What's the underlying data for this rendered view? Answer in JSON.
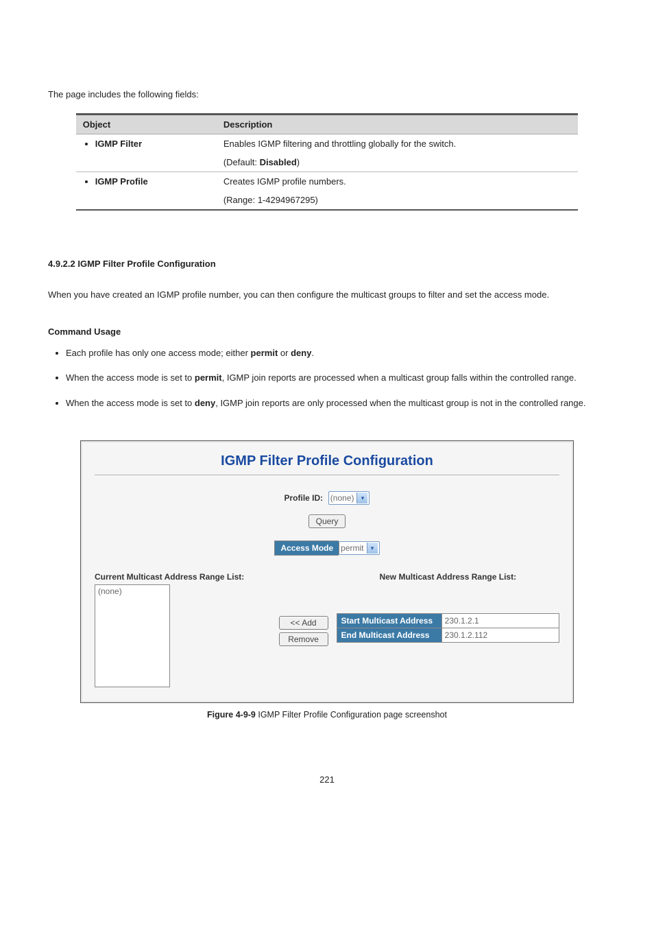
{
  "intro": "The page includes the following fields:",
  "table": {
    "h1": "Object",
    "h2": "Description",
    "rows": [
      {
        "obj": "IGMP Filter",
        "d1": "Enables IGMP filtering and throttling globally for the switch.",
        "d2a": "(Default: ",
        "d2b": "Disabled",
        "d2c": ")"
      },
      {
        "obj": "IGMP Profile",
        "d1": "Creates IGMP profile numbers.",
        "d2": "(Range: 1-4294967295)"
      }
    ]
  },
  "section_num": "4.9.2.2 IGMP Filter Profile Configuration",
  "section_para": "When you have created an IGMP profile number, you can then configure the multicast groups to filter and set the access mode.",
  "usage_head": "Command Usage",
  "usage": {
    "i1a": "Each profile has only one access mode; either ",
    "i1b": "permit",
    "i1c": " or ",
    "i1d": "deny",
    "i1e": ".",
    "i2a": "When the access mode is set to ",
    "i2b": "permit",
    "i2c": ", IGMP join reports are processed when a multicast group falls within the controlled range.",
    "i3a": "When the access mode is set to ",
    "i3b": "deny",
    "i3c": ", IGMP join reports are only processed when the multicast group is not in the controlled range."
  },
  "shot": {
    "title": "IGMP Filter Profile Configuration",
    "profile_label": "Profile ID:",
    "profile_value": "(none)",
    "query_btn": "Query",
    "access_label": "Access Mode",
    "access_value": "permit",
    "cur_hdr": "Current Multicast Address Range List:",
    "cur_item": "(none)",
    "new_hdr": "New Multicast Address Range List:",
    "add_btn": "<< Add",
    "remove_btn": "Remove",
    "start_lbl": "Start Multicast Address",
    "start_val": "230.1.2.1",
    "end_lbl": "End Multicast Address",
    "end_val": "230.1.2.112"
  },
  "caption_b": "Figure 4-9-9",
  "caption_r": " IGMP Filter Profile Configuration page screenshot",
  "page_number": "221"
}
